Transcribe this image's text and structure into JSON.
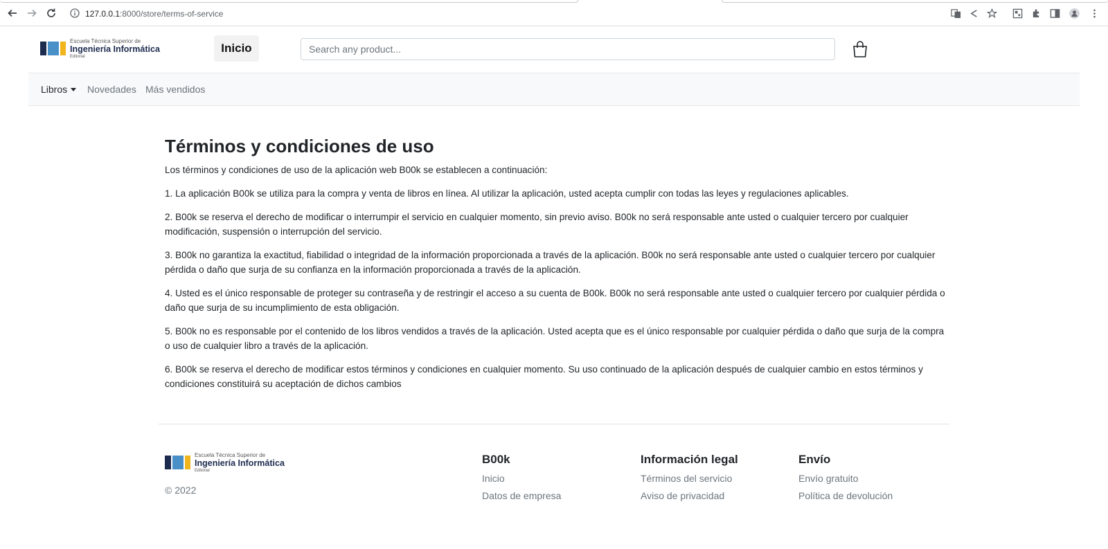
{
  "browser": {
    "url_host": "127.0.0.1",
    "url_path": ":8000/store/terms-of-service"
  },
  "header": {
    "logo": {
      "line1": "Escuela Técnica Superior de",
      "line2": "Ingeniería Informática",
      "line3": "Editorial"
    },
    "home_label": "Inicio",
    "search_placeholder": "Search any product...",
    "cart_icon": "shopping-bag-icon"
  },
  "navbar": {
    "items": [
      {
        "label": "Libros",
        "dropdown": true
      },
      {
        "label": "Novedades"
      },
      {
        "label": "Más vendidos"
      }
    ]
  },
  "main": {
    "title": "Términos y condiciones de uso",
    "intro": "Los términos y condiciones de uso de la aplicación web B00k se establecen a continuación:",
    "clauses": [
      "1. La aplicación B00k se utiliza para la compra y venta de libros en línea. Al utilizar la aplicación, usted acepta cumplir con todas las leyes y regulaciones aplicables.",
      "2. B00k se reserva el derecho de modificar o interrumpir el servicio en cualquier momento, sin previo aviso. B00k no será responsable ante usted o cualquier tercero por cualquier modificación, suspensión o interrupción del servicio.",
      "3. B00k no garantiza la exactitud, fiabilidad o integridad de la información proporcionada a través de la aplicación. B00k no será responsable ante usted o cualquier tercero por cualquier pérdida o daño que surja de su confianza en la información proporcionada a través de la aplicación.",
      "4. Usted es el único responsable de proteger su contraseña y de restringir el acceso a su cuenta de B00k. B00k no será responsable ante usted o cualquier tercero por cualquier pérdida o daño que surja de su incumplimiento de esta obligación.",
      "5. B00k no es responsable por el contenido de los libros vendidos a través de la aplicación. Usted acepta que es el único responsable por cualquier pérdida o daño que surja de la compra o uso de cualquier libro a través de la aplicación.",
      "6. B00k se reserva el derecho de modificar estos términos y condiciones en cualquier momento. Su uso continuado de la aplicación después de cualquier cambio en estos términos y condiciones constituirá su aceptación de dichos cambios"
    ]
  },
  "footer": {
    "copyright": "© 2022",
    "columns": [
      {
        "title": "B00k",
        "links": [
          "Inicio",
          "Datos de empresa"
        ]
      },
      {
        "title": "Información legal",
        "links": [
          "Términos del servicio",
          "Aviso de privacidad"
        ]
      },
      {
        "title": "Envío",
        "links": [
          "Envío gratuito",
          "Política de devolución"
        ]
      }
    ]
  },
  "colors": {
    "logo_dark": "#1d2b4f",
    "logo_blue": "#4a90c8",
    "logo_yellow": "#f0b41c",
    "navbar_bg": "#f8f9fa",
    "muted_text": "#6c757d"
  }
}
